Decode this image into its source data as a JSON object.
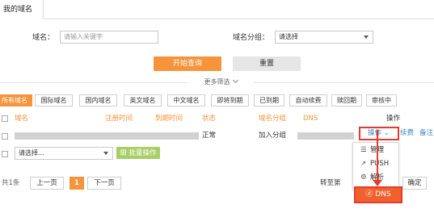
{
  "tab": {
    "label": "我的域名"
  },
  "search": {
    "domain_label": "域名：",
    "domain_placeholder": "请输入关键字",
    "group_label": "域名分组：",
    "group_value": "请选择",
    "search_button": "开始查询",
    "reset_button": "重置",
    "more_filter": "更多筛选"
  },
  "filters": [
    {
      "label": "所有域名",
      "active": true
    },
    {
      "label": "国际域名"
    },
    {
      "label": "国内域名"
    },
    {
      "label": "英文域名"
    },
    {
      "label": "中文域名"
    },
    {
      "label": "即将到期"
    },
    {
      "label": "已到期"
    },
    {
      "label": "自动续费"
    },
    {
      "label": "赎回期"
    },
    {
      "label": "审核中"
    }
  ],
  "table": {
    "headers": {
      "domain": "域名",
      "reg_time": "注册时间",
      "exp_time": "到期时间",
      "status": "状态",
      "group": "域名分组",
      "dns": "DNS",
      "action": "操作"
    },
    "row": {
      "status": "正常",
      "group": "加入分组",
      "action_label": "操作",
      "renew": "续费",
      "note": "备注"
    }
  },
  "bulk": {
    "select_value": "请选择...",
    "bulk_button": "批量操作"
  },
  "pagination": {
    "total": "共1条",
    "prev": "上一页",
    "current": "1",
    "next": "下一页",
    "goto_label": "转至第",
    "confirm": "确定"
  },
  "action_menu": {
    "items": [
      {
        "label": "管理",
        "icon": "list-icon"
      },
      {
        "label": "PUSH",
        "icon": "push-icon"
      },
      {
        "label": "解析",
        "icon": "settings-icon"
      }
    ],
    "highlight": {
      "label": "DNS",
      "icon": "dns-icon"
    }
  },
  "colors": {
    "accent": "#f5943b",
    "link": "#3b87c8",
    "green": "#a8cf67",
    "highlight_red": "#e33b2f"
  }
}
